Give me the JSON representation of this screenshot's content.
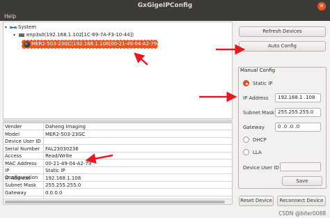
{
  "window": {
    "title": "GxGigeIPConfig"
  },
  "menu": {
    "help": "Help"
  },
  "tree": {
    "root": "System",
    "adapter": "enp3s0(192.168.1.102[1C-69-7A-F3-10-44])",
    "device": "MER2-503-23GC(192.168.1.108[00-21-49-04-A2-79])"
  },
  "properties": [
    {
      "key": "Vender",
      "value": "Daheng Imaging"
    },
    {
      "key": "Model",
      "value": "MER2-503-23GC"
    },
    {
      "key": "Device User ID",
      "value": ""
    },
    {
      "key": "Serial Number",
      "value": "FAL23030236"
    },
    {
      "key": "Access",
      "value": "Read/Write"
    },
    {
      "key": "MAC Address",
      "value": "00-21-49-04-A2-79"
    },
    {
      "key": "IP Configuration",
      "value": "Static IP"
    },
    {
      "key": "IP Address",
      "value": "192.168.1.108"
    },
    {
      "key": "Subnet Mask",
      "value": "255.255.255.0"
    },
    {
      "key": "Gateway",
      "value": "0.0.0.0"
    }
  ],
  "buttons": {
    "refresh": "Refresh Devices",
    "auto_config": "Auto Config",
    "save": "Save",
    "reset": "Reset Device",
    "reconnect": "Reconnect Device"
  },
  "manual_config": {
    "title": "Manual Config",
    "static_ip_label": "Static IP",
    "ip_label": "IP Address",
    "ip_value": "192.168.1  .108",
    "subnet_label": "Subnet Mask",
    "subnet_value": "255.255.255.0",
    "gateway_label": "Gateway",
    "gateway_value": "0  .0  .0  .0",
    "dhcp_label": "DHCP",
    "lla_label": "LLA",
    "user_id_label": "Device User ID",
    "user_id_value": "",
    "mode": "Static IP"
  },
  "watermark": "CSDN @biter0088",
  "colors": {
    "accent": "#e95420",
    "arrow": "#e8191e",
    "titlebar": "#3c3b37"
  }
}
